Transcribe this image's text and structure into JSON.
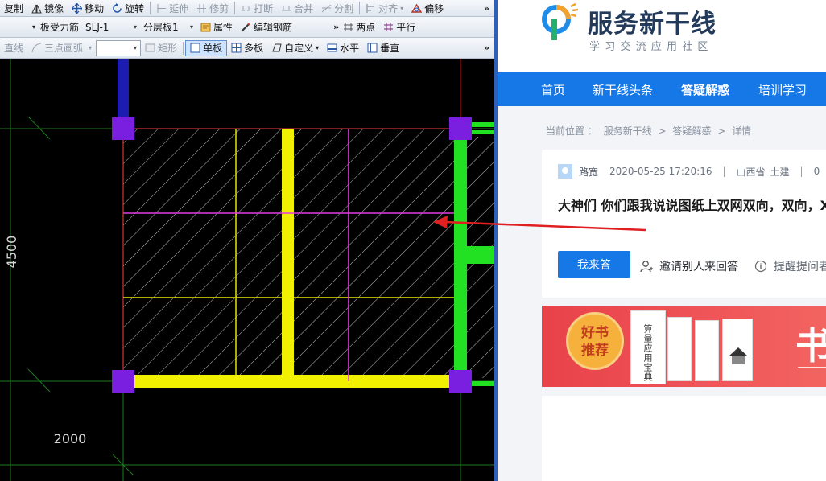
{
  "cad": {
    "toolbar1": [
      {
        "label": "复制",
        "disabled": false
      },
      {
        "label": "镜像",
        "disabled": false
      },
      {
        "label": "移动",
        "disabled": false
      },
      {
        "label": "旋转",
        "disabled": false
      },
      {
        "label": "延伸",
        "disabled": true
      },
      {
        "label": "修剪",
        "disabled": true
      },
      {
        "label": "打断",
        "disabled": true
      },
      {
        "label": "合并",
        "disabled": true
      },
      {
        "label": "分割",
        "disabled": true
      },
      {
        "label": "对齐",
        "disabled": true
      },
      {
        "label": "偏移",
        "disabled": false
      }
    ],
    "toolbar2": {
      "combo1": "板受力筋",
      "combo2": "SLJ-1",
      "combo3": "分层板1",
      "props": "属性",
      "edit_rebar": "编辑钢筋",
      "two_points": "两点",
      "parallel": "平行"
    },
    "toolbar3": {
      "line": "直线",
      "arc": "三点画弧",
      "rect": "矩形",
      "single": "单板",
      "multi": "多板",
      "custom": "自定义",
      "horizontal": "水平",
      "vertical": "垂直"
    },
    "dims": {
      "vertical": "4500",
      "horizontal": "2000"
    }
  },
  "web": {
    "logo_title": "服务新干线",
    "logo_sub": "学习交流应用社区",
    "nav": [
      "首页",
      "新干线头条",
      "答疑解惑",
      "培训学习"
    ],
    "nav_active": "答疑解惑",
    "breadcrumb": {
      "label": "当前位置 ：",
      "items": [
        "服务新干线",
        "答疑解惑",
        "详情"
      ],
      "sep": ">"
    },
    "post": {
      "author": "路宽",
      "time": "2020-05-25 17:20:16",
      "location": "山西省",
      "category": "土建",
      "extra": "0",
      "title": "大神们 你们跟我说说图纸上双网双向，双向，X"
    },
    "actions": {
      "answer": "我来答",
      "invite": "邀请别人来回答",
      "remind": "提醒提问者"
    },
    "banner": {
      "badge_line1": "好书",
      "badge_line2": "推荐",
      "book_title": "算量应用宝典",
      "big_text": "书"
    }
  },
  "colors": {
    "nav_blue": "#1677e6",
    "annotation_arrow": "#e02020"
  }
}
